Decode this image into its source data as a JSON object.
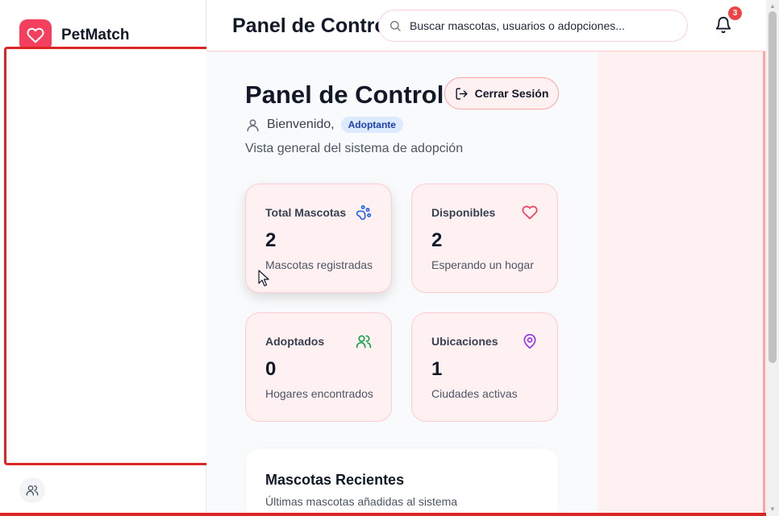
{
  "app": {
    "brand": "PetMatch"
  },
  "header": {
    "title": "Panel de Control",
    "search_placeholder": "Buscar mascotas, usuarios o adopciones...",
    "notification_count": "3"
  },
  "main": {
    "title": "Panel de Control",
    "logout_label": "Cerrar Sesión",
    "welcome": "Bienvenido,",
    "role": "Adoptante",
    "subtitle": "Vista general del sistema de adopción"
  },
  "stats": [
    {
      "label": "Total Mascotas",
      "value": "2",
      "caption": "Mascotas registradas",
      "icon": "paw-icon"
    },
    {
      "label": "Disponibles",
      "value": "2",
      "caption": "Esperando un hogar",
      "icon": "heart-icon"
    },
    {
      "label": "Adoptados",
      "value": "0",
      "caption": "Hogares encontrados",
      "icon": "users-icon"
    },
    {
      "label": "Ubicaciones",
      "value": "1",
      "caption": "Ciudades activas",
      "icon": "map-pin-icon"
    }
  ],
  "recent": {
    "title": "Mascotas Recientes",
    "subtitle": "Últimas mascotas añadidas al sistema"
  },
  "colors": {
    "brand": "#f43f5e",
    "card_bg": "#fff1f2",
    "paw_icon": "#2563eb",
    "heart_icon": "#f43f5e",
    "users_icon": "#16a34a",
    "pin_icon": "#9333ea",
    "badge": "#ef4444",
    "highlight": "#dc2626"
  }
}
